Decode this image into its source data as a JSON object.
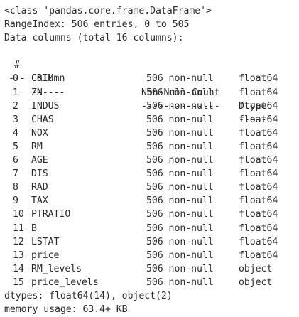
{
  "class_line": "<class 'pandas.core.frame.DataFrame'>",
  "range_index": "RangeIndex: 506 entries, 0 to 505",
  "data_columns": "Data columns (total 16 columns):",
  "header": {
    "idx": "#",
    "column": "Column",
    "count": "Non-Null Count",
    "dtype": "Dtype"
  },
  "separator": {
    "idx": "---",
    "column": "------",
    "count": "--------------",
    "dtype": "-----"
  },
  "rows": [
    {
      "idx": "0",
      "column": "CRIM",
      "count": "506 non-null",
      "dtype": "float64"
    },
    {
      "idx": "1",
      "column": "ZN",
      "count": "506 non-null",
      "dtype": "float64"
    },
    {
      "idx": "2",
      "column": "INDUS",
      "count": "506 non-null",
      "dtype": "float64"
    },
    {
      "idx": "3",
      "column": "CHAS",
      "count": "506 non-null",
      "dtype": "float64"
    },
    {
      "idx": "4",
      "column": "NOX",
      "count": "506 non-null",
      "dtype": "float64"
    },
    {
      "idx": "5",
      "column": "RM",
      "count": "506 non-null",
      "dtype": "float64"
    },
    {
      "idx": "6",
      "column": "AGE",
      "count": "506 non-null",
      "dtype": "float64"
    },
    {
      "idx": "7",
      "column": "DIS",
      "count": "506 non-null",
      "dtype": "float64"
    },
    {
      "idx": "8",
      "column": "RAD",
      "count": "506 non-null",
      "dtype": "float64"
    },
    {
      "idx": "9",
      "column": "TAX",
      "count": "506 non-null",
      "dtype": "float64"
    },
    {
      "idx": "10",
      "column": "PTRATIO",
      "count": "506 non-null",
      "dtype": "float64"
    },
    {
      "idx": "11",
      "column": "B",
      "count": "506 non-null",
      "dtype": "float64"
    },
    {
      "idx": "12",
      "column": "LSTAT",
      "count": "506 non-null",
      "dtype": "float64"
    },
    {
      "idx": "13",
      "column": "price",
      "count": "506 non-null",
      "dtype": "float64"
    },
    {
      "idx": "14",
      "column": "RM_levels",
      "count": "506 non-null",
      "dtype": "object"
    },
    {
      "idx": "15",
      "column": "price_levels",
      "count": "506 non-null",
      "dtype": "object"
    }
  ],
  "dtypes_line": "dtypes: float64(14), object(2)",
  "memory_line": "memory usage: 63.4+ KB"
}
